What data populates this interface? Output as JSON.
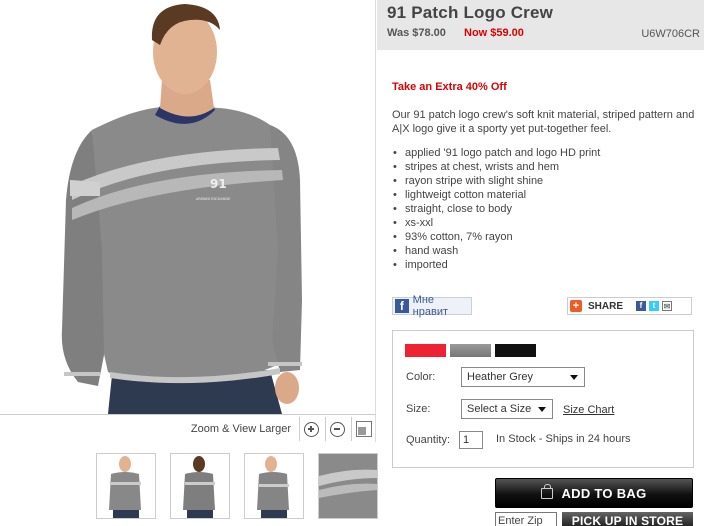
{
  "product": {
    "title": "91 Patch Logo Crew",
    "was_price": "Was $78.00",
    "now_price": "Now $59.00",
    "sku": "U6W706CR",
    "promo": "Take an Extra 40% Off",
    "description": "Our 91 patch logo crew's soft knit material, striped pattern and A|X logo give it a sporty yet put-together feel.",
    "features": [
      "applied '91 logo patch and logo HD print",
      "stripes at chest, wrists and hem",
      "rayon stripe with slight shine",
      "lightweigt cotton material",
      "straight, close to body",
      "xs-xxl",
      "93% cotton, 7% rayon",
      "hand wash",
      "imported"
    ]
  },
  "image": {
    "zoom_label": "Zoom & View Larger",
    "patch_text": "91",
    "logo_text": "ARMANI EXCHANGE"
  },
  "social": {
    "like_label": "Мне нравит",
    "share_label": "SHARE"
  },
  "options": {
    "swatch_colors": [
      "#ee2233",
      "#808080",
      "#111111"
    ],
    "color_label": "Color:",
    "color_value": "Heather Grey",
    "size_label": "Size:",
    "size_value": "Select a Size",
    "size_chart": "Size Chart",
    "quantity_label": "Quantity:",
    "quantity_value": "1",
    "stock_text": "In Stock - Ships in 24 hours"
  },
  "actions": {
    "add_to_bag": "ADD TO BAG",
    "zip_placeholder": "Enter Zip",
    "pick_up": "PICK UP IN STORE"
  }
}
